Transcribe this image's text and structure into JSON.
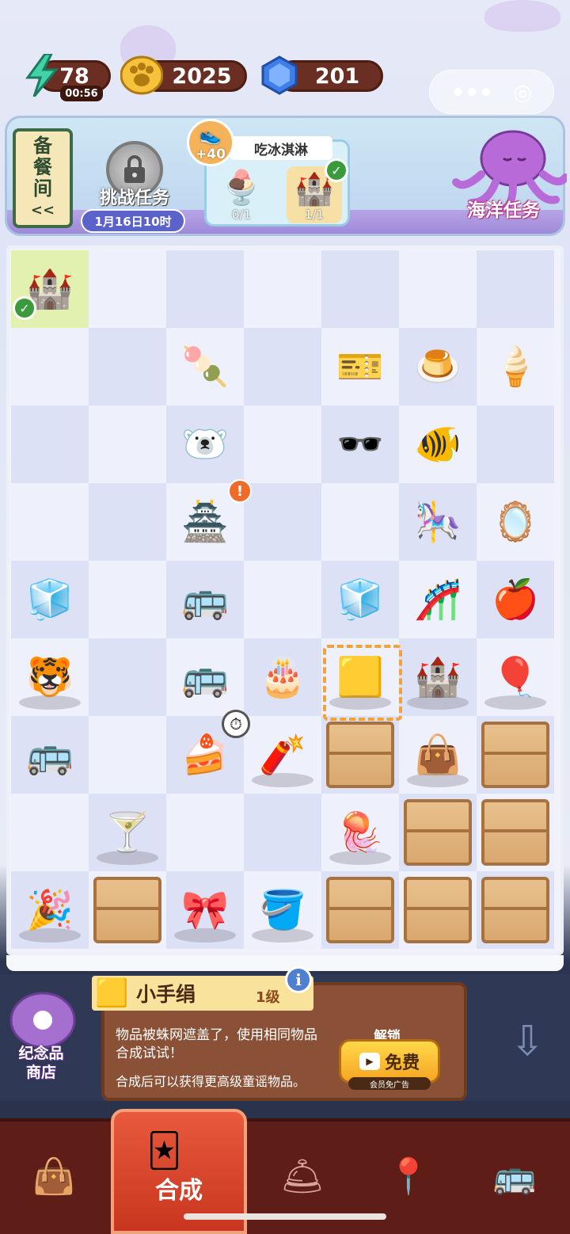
{
  "currency": {
    "energy": {
      "value": "78",
      "timer": "00:56",
      "icon": "lightning-icon"
    },
    "coins": {
      "value": "2025",
      "icon": "paw-coin-icon"
    },
    "gems": {
      "value": "201",
      "icon": "gem-icon"
    }
  },
  "miniapp_capsule": {
    "more": "•••",
    "close": "◎"
  },
  "header": {
    "side_scroll": {
      "line1": "备",
      "line2": "餐",
      "line3": "间",
      "arrow": "<<"
    },
    "challenge": {
      "label": "挑战任务",
      "date": "1月16日10时"
    },
    "task": {
      "title": "吃冰淇淋",
      "reward": "+40",
      "slots": [
        {
          "icon": "ice-cream-sundae-icon",
          "progress": "0/1"
        },
        {
          "icon": "castle-badge-icon",
          "progress": "1/1"
        }
      ]
    },
    "ocean_task": {
      "label": "海洋任务"
    }
  },
  "info_panel": {
    "item_name": "小手绢",
    "level": "1级",
    "info_icon": "i",
    "description": "物品被蛛网遮盖了，使用相同物品合成试试！",
    "description2": "合成后可以获得更高级童谣物品。",
    "unlock_label": "解锁",
    "free_button": "免费",
    "vip_note": "会员免广告",
    "shop_label_1": "纪念品",
    "shop_label_2": "商店"
  },
  "nav": {
    "active_label": "合成",
    "items": [
      "bag-icon",
      "merge-icon",
      "service-bell-icon",
      "map-pin-icon",
      "bus-icon"
    ]
  }
}
